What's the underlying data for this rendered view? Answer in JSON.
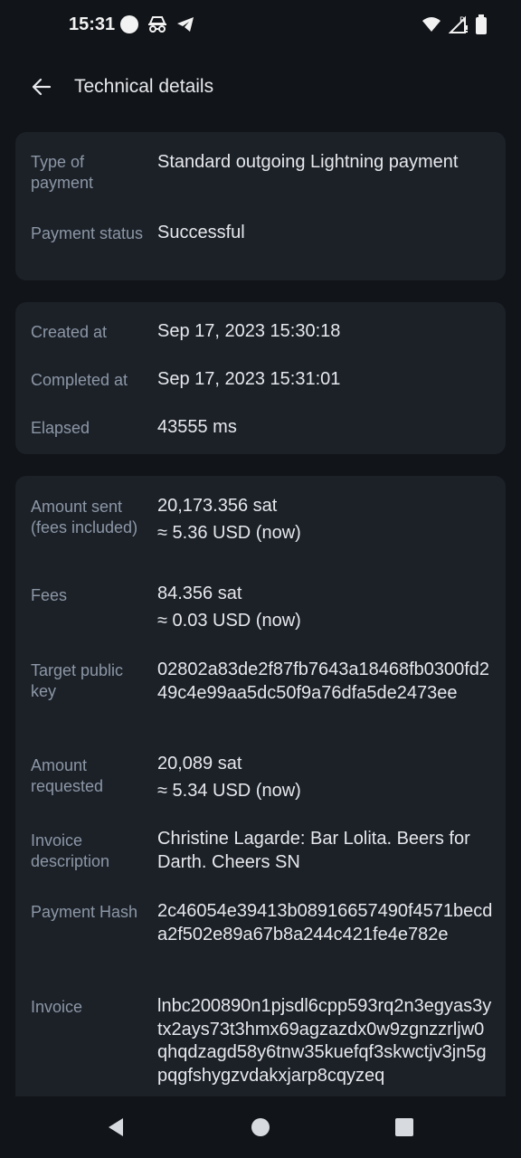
{
  "status_bar": {
    "time": "15:31",
    "left_icons": [
      "circle-icon",
      "incognito-icon",
      "telegram-icon"
    ],
    "right_icons": [
      "wifi-icon",
      "signal-roaming-icon",
      "battery-icon"
    ]
  },
  "app_bar": {
    "title": "Technical details"
  },
  "card1": {
    "rows": [
      {
        "label": "Type of payment",
        "value": "Standard outgoing Lightning payment"
      },
      {
        "label": "Payment status",
        "value": "Successful"
      }
    ]
  },
  "card2": {
    "rows": [
      {
        "label": "Created at",
        "value": "Sep 17, 2023 15:30:18"
      },
      {
        "label": "Completed at",
        "value": "Sep 17, 2023 15:31:01"
      },
      {
        "label": "Elapsed",
        "value": "43555 ms"
      }
    ]
  },
  "card3": {
    "rows": [
      {
        "label": "Amount sent (fees included)",
        "value": "20,173.356 sat",
        "sub": "≈ 5.36 USD (now)"
      },
      {
        "label": "Fees",
        "value": "84.356 sat",
        "sub": "≈ 0.03 USD (now)"
      },
      {
        "label": "Target public key",
        "value": "02802a83de2f87fb7643a18468fb0300fd249c4e99aa5dc50f9a76dfa5de2473ee"
      },
      {
        "label": "Amount requested",
        "value": "20,089 sat",
        "sub": "≈ 5.34 USD (now)"
      },
      {
        "label": "Invoice description",
        "value": "Christine Lagarde:  Bar Lolita. Beers for Darth. Cheers SN"
      },
      {
        "label": "Payment Hash",
        "value": "2c46054e39413b08916657490f4571becda2f502e89a67b8a244c421fe4e782e"
      },
      {
        "label": "Invoice",
        "value": "lnbc200890n1pjsdl6cpp593rq2n3egyas3ytx2ays73t3hmx69agzazdx0w9zgnzzrljw0qhqdzagd58y6tnw35kuefqf3skwctjv3jn5gpqgfshygzvdakxjarp8cqyzeq"
      }
    ]
  },
  "nav_bar": {
    "buttons": [
      "back-triangle-icon",
      "home-circle-icon",
      "recents-square-icon"
    ]
  },
  "colors": {
    "background": "#111418",
    "card": "#1c2128",
    "label": "#8c97a6",
    "text": "#e6e8ec"
  }
}
